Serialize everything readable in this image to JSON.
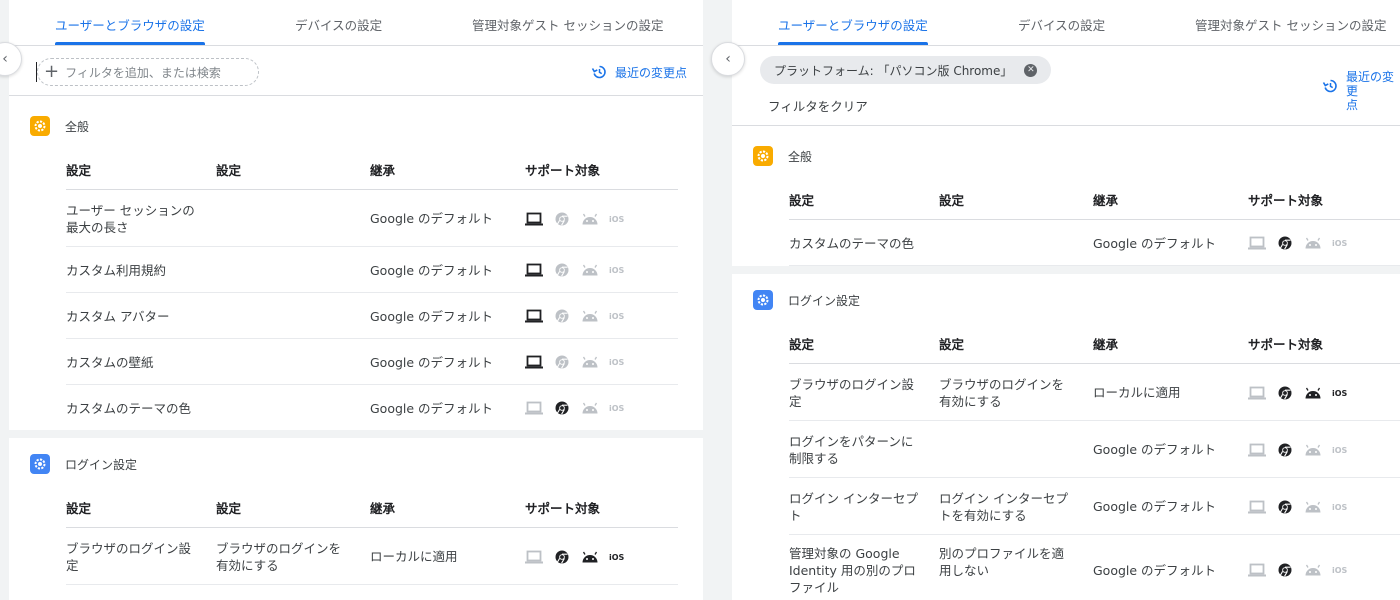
{
  "tabs": [
    "ユーザーとブラウザの設定",
    "デバイスの設定",
    "管理対象ゲスト セッションの設定"
  ],
  "filter": {
    "placeholder": "フィルタを追加、または検索",
    "chip_label": "プラットフォーム: 「パソコン版 Chrome」",
    "clear_label": "フィルタをクリア"
  },
  "recent_changes_label": "最近の変更点",
  "recent_changes_label_wrapped": [
    "最近の変更",
    "点"
  ],
  "columns": [
    "設定",
    "設定",
    "継承",
    "サポート対象"
  ],
  "platform_icons": [
    "laptop-icon",
    "chrome-icon",
    "android-icon",
    "ios-icon"
  ],
  "colors": {
    "accent": "#1a73e8",
    "general_icon": "#f9ab00",
    "login_icon": "#4285f4",
    "supported": "#202124",
    "unsupported": "#bdc1c6"
  },
  "left": {
    "general": {
      "title": "全般",
      "rows": [
        {
          "name": "ユーザー セッションの\n最大の長さ",
          "value": "",
          "inherit": "Google のデフォルト",
          "supported": [
            true,
            false,
            false,
            false
          ]
        },
        {
          "name": "カスタム利用規約",
          "value": "",
          "inherit": "Google のデフォルト",
          "supported": [
            true,
            false,
            false,
            false
          ]
        },
        {
          "name": "カスタム アバター",
          "value": "",
          "inherit": "Google のデフォルト",
          "supported": [
            true,
            false,
            false,
            false
          ]
        },
        {
          "name": "カスタムの壁紙",
          "value": "",
          "inherit": "Google のデフォルト",
          "supported": [
            true,
            false,
            false,
            false
          ]
        },
        {
          "name": "カスタムのテーマの色",
          "value": "",
          "inherit": "Google のデフォルト",
          "supported": [
            false,
            true,
            false,
            false
          ]
        }
      ]
    },
    "login": {
      "title": "ログイン設定",
      "rows": [
        {
          "name": "ブラウザのログイン設\n定",
          "value": "ブラウザのログインを\n有効にする",
          "inherit": "ローカルに適用",
          "supported": [
            false,
            true,
            true,
            true
          ]
        }
      ]
    }
  },
  "right": {
    "general": {
      "title": "全般",
      "rows": [
        {
          "name": "カスタムのテーマの色",
          "value": "",
          "inherit": "Google のデフォルト",
          "supported": [
            false,
            true,
            false,
            false
          ]
        }
      ]
    },
    "login": {
      "title": "ログイン設定",
      "rows": [
        {
          "name": "ブラウザのログイン設\n定",
          "value": "ブラウザのログインを\n有効にする",
          "inherit": "ローカルに適用",
          "supported": [
            false,
            true,
            true,
            true
          ]
        },
        {
          "name": "ログインをパターンに\n制限する",
          "value": "",
          "inherit": "Google のデフォルト",
          "supported": [
            false,
            true,
            false,
            false
          ]
        },
        {
          "name": "ログイン インターセプ\nト",
          "value": "ログイン インターセプ\nトを有効にする",
          "inherit": "Google のデフォルト",
          "supported": [
            false,
            true,
            false,
            false
          ]
        },
        {
          "name": "管理対象の Google\nIdentity 用の別のプロ\nファイル",
          "value": "別のプロファイルを適\n用しない",
          "inherit": "Google のデフォルト",
          "supported": [
            false,
            true,
            false,
            false
          ]
        }
      ]
    }
  }
}
